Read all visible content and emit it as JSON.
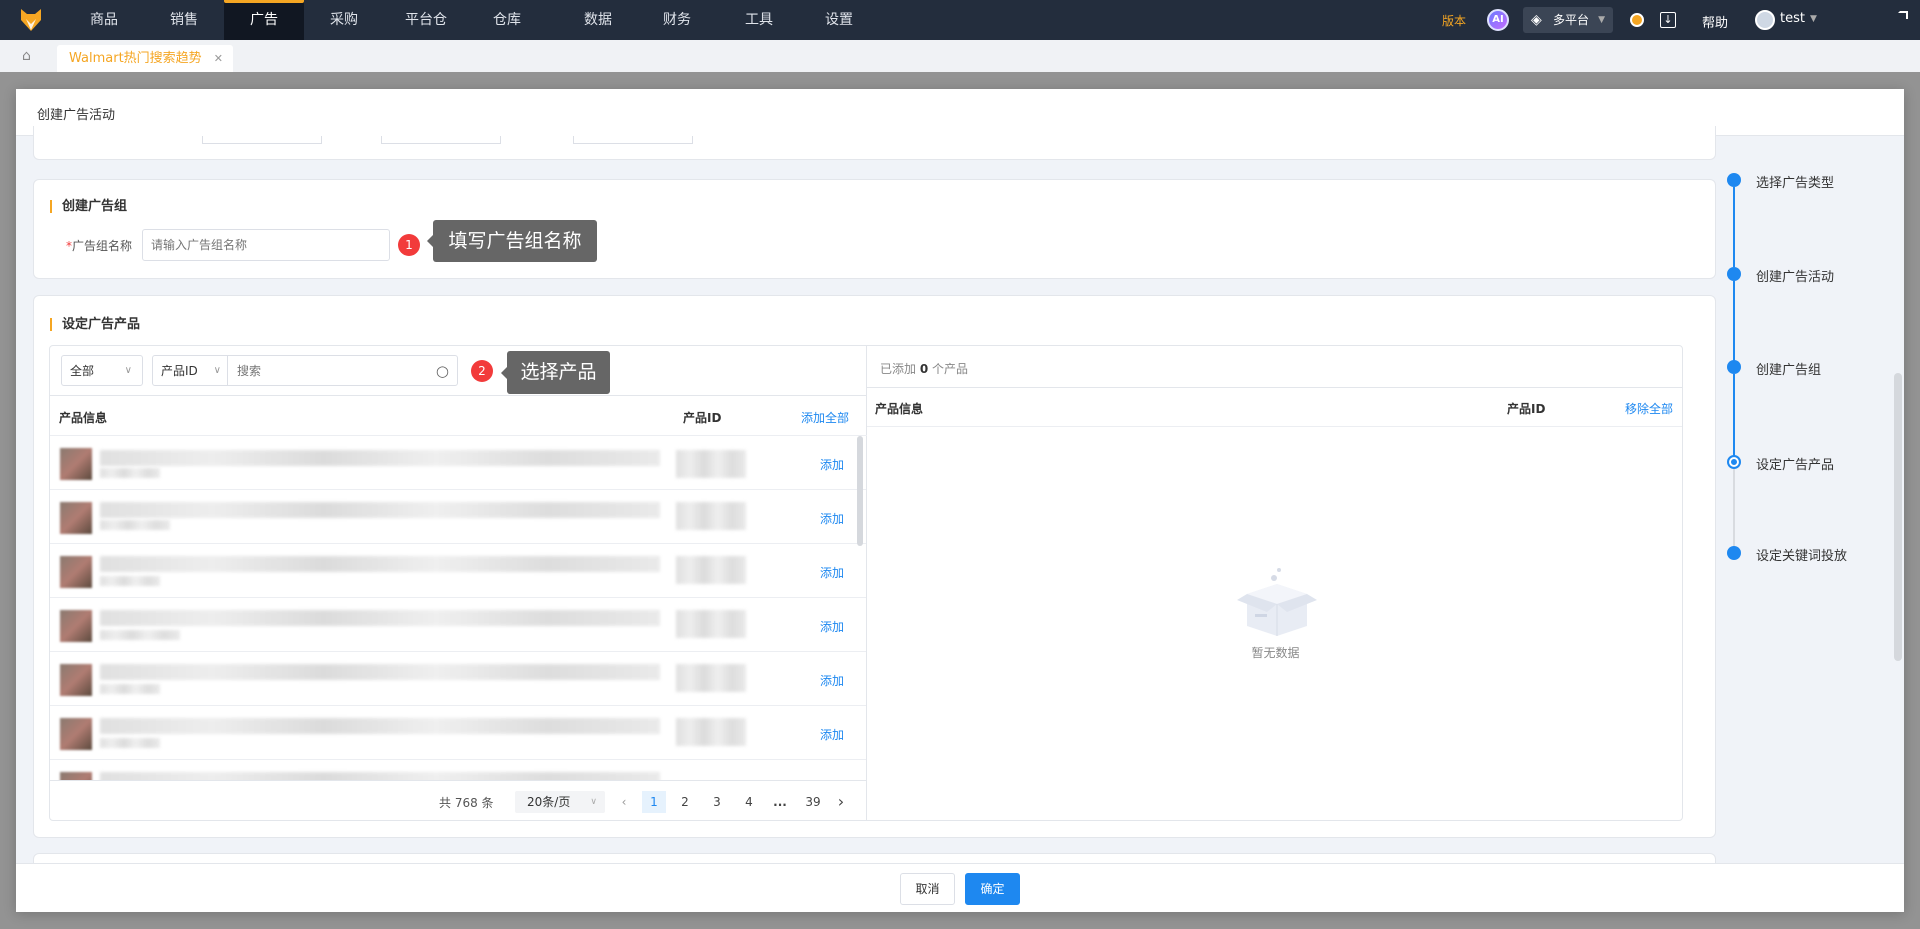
{
  "nav": {
    "items": [
      "商品",
      "销售",
      "广告",
      "采购",
      "平台仓",
      "仓库",
      "数据",
      "财务",
      "工具",
      "设置"
    ],
    "active": "广告",
    "version": "版本",
    "ai": "AI",
    "platform": "多平台",
    "help": "帮助",
    "user": "test"
  },
  "tabs": {
    "active_tab": "Walmart热门搜索趋势",
    "close": "✕"
  },
  "modal": {
    "title": "创建广告活动",
    "ad_group": {
      "title": "创建广告组",
      "label": "广告组名称",
      "required": "*",
      "placeholder": "请输入广告组名称",
      "badge": "1",
      "tip": "填写广告组名称"
    },
    "products": {
      "title": "设定广告产品",
      "filter": "全部",
      "field": "产品ID",
      "search_placeholder": "搜索",
      "badge": "2",
      "tip": "选择产品",
      "left": {
        "col_info": "产品信息",
        "col_id": "产品ID",
        "add_all": "添加全部",
        "add": "添加"
      },
      "pagination": {
        "total": "共 768 条",
        "page_size": "20条/页",
        "pages": [
          "1",
          "2",
          "3",
          "4",
          "...",
          "39"
        ],
        "current": "1"
      },
      "right": {
        "added_prefix": "已添加",
        "added_count": "0",
        "added_suffix": "个产品",
        "col_info": "产品信息",
        "col_id": "产品ID",
        "remove_all": "移除全部",
        "empty": "暂无数据"
      }
    },
    "cancel": "取消",
    "confirm": "确定"
  },
  "steps": [
    {
      "label": "选择广告类型"
    },
    {
      "label": "创建广告活动"
    },
    {
      "label": "创建广告组"
    },
    {
      "label": "设定广告产品"
    },
    {
      "label": "设定关键词投放"
    }
  ],
  "colors": {
    "accent": "#1e88f0",
    "brand": "#f5a623",
    "nav": "#232d3d",
    "badge": "#f23b3b"
  }
}
